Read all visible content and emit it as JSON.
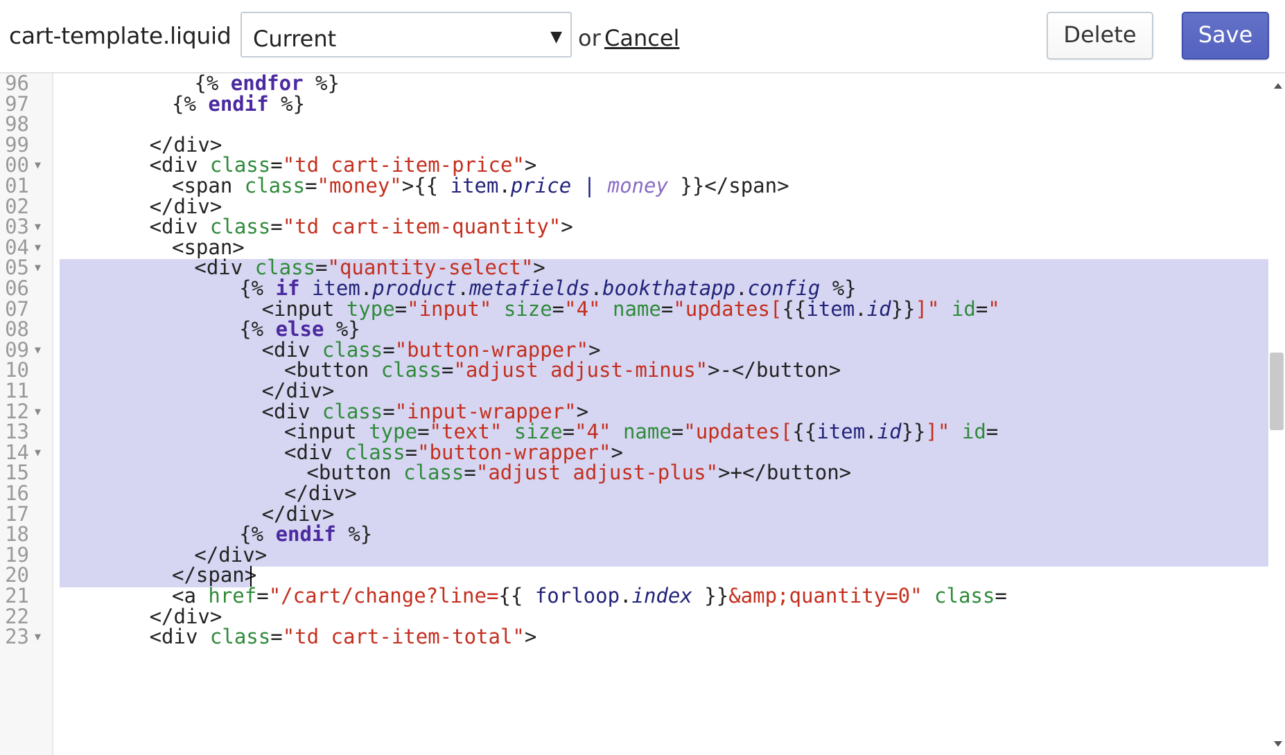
{
  "toolbar": {
    "file_name": "cart-template.liquid",
    "version_select": {
      "selected": "Current"
    },
    "or_text": "or",
    "cancel_label": "Cancel",
    "delete_label": "Delete",
    "save_label": "Save"
  },
  "colors": {
    "save_button": "#5563c1",
    "selection": "#d6d6f2",
    "tag_text": "#222222",
    "attribute": "#2f8a3a",
    "string": "#c42e1e",
    "keyword": "#4b2aa0",
    "variable": "#22227a",
    "filter": "#8a6bc4"
  },
  "editor": {
    "selection": {
      "start_line": "05",
      "end_line": "20"
    },
    "lines": [
      {
        "num": "96",
        "indent": 12,
        "fold": false,
        "tokens": [
          [
            "text",
            "{% "
          ],
          [
            "kw",
            "endfor"
          ],
          [
            "text",
            " %}"
          ]
        ]
      },
      {
        "num": "97",
        "indent": 10,
        "fold": false,
        "tokens": [
          [
            "text",
            "{% "
          ],
          [
            "kw",
            "endif"
          ],
          [
            "text",
            " %}"
          ]
        ]
      },
      {
        "num": "98",
        "indent": 0,
        "fold": false,
        "tokens": []
      },
      {
        "num": "99",
        "indent": 8,
        "fold": false,
        "tokens": [
          [
            "text",
            "</div>"
          ]
        ]
      },
      {
        "num": "00",
        "indent": 8,
        "fold": true,
        "tokens": [
          [
            "text",
            "<div "
          ],
          [
            "attr",
            "class"
          ],
          [
            "text",
            "="
          ],
          [
            "str",
            "\"td cart-item-price\""
          ],
          [
            "text",
            ">"
          ]
        ]
      },
      {
        "num": "01",
        "indent": 10,
        "fold": false,
        "tokens": [
          [
            "text",
            "<span "
          ],
          [
            "attr",
            "class"
          ],
          [
            "text",
            "="
          ],
          [
            "str",
            "\"money\""
          ],
          [
            "text",
            ">{{ "
          ],
          [
            "var",
            "item"
          ],
          [
            "text",
            "."
          ],
          [
            "prop",
            "price"
          ],
          [
            "text",
            " "
          ],
          [
            "punct",
            "|"
          ],
          [
            "text",
            " "
          ],
          [
            "filter",
            "money"
          ],
          [
            "text",
            " }}</span>"
          ]
        ]
      },
      {
        "num": "02",
        "indent": 8,
        "fold": false,
        "tokens": [
          [
            "text",
            "</div>"
          ]
        ]
      },
      {
        "num": "03",
        "indent": 8,
        "fold": true,
        "tokens": [
          [
            "text",
            "<div "
          ],
          [
            "attr",
            "class"
          ],
          [
            "text",
            "="
          ],
          [
            "str",
            "\"td cart-item-quantity\""
          ],
          [
            "text",
            ">"
          ]
        ]
      },
      {
        "num": "04",
        "indent": 10,
        "fold": true,
        "tokens": [
          [
            "text",
            "<span>"
          ]
        ]
      },
      {
        "num": "05",
        "indent": 12,
        "fold": true,
        "tokens": [
          [
            "text",
            "<div "
          ],
          [
            "attr",
            "class"
          ],
          [
            "text",
            "="
          ],
          [
            "str",
            "\"quantity-select\""
          ],
          [
            "text",
            ">"
          ]
        ]
      },
      {
        "num": "06",
        "indent": 16,
        "fold": false,
        "tokens": [
          [
            "text",
            "{% "
          ],
          [
            "kw",
            "if"
          ],
          [
            "text",
            " "
          ],
          [
            "var",
            "item"
          ],
          [
            "text",
            "."
          ],
          [
            "prop",
            "product"
          ],
          [
            "text",
            "."
          ],
          [
            "prop",
            "metafields"
          ],
          [
            "text",
            "."
          ],
          [
            "prop",
            "bookthatapp"
          ],
          [
            "text",
            "."
          ],
          [
            "prop",
            "config"
          ],
          [
            "text",
            " %}"
          ]
        ]
      },
      {
        "num": "07",
        "indent": 18,
        "fold": false,
        "tokens": [
          [
            "text",
            "<input "
          ],
          [
            "attr",
            "type"
          ],
          [
            "text",
            "="
          ],
          [
            "str",
            "\"input\""
          ],
          [
            "text",
            " "
          ],
          [
            "attr",
            "size"
          ],
          [
            "text",
            "="
          ],
          [
            "str",
            "\"4\""
          ],
          [
            "text",
            " "
          ],
          [
            "attr",
            "name"
          ],
          [
            "text",
            "="
          ],
          [
            "str",
            "\"updates["
          ],
          [
            "text",
            "{{"
          ],
          [
            "var",
            "item"
          ],
          [
            "text",
            "."
          ],
          [
            "prop",
            "id"
          ],
          [
            "text",
            "}}"
          ],
          [
            "str",
            "]\""
          ],
          [
            "text",
            " "
          ],
          [
            "attr",
            "id"
          ],
          [
            "text",
            "="
          ],
          [
            "str",
            "\""
          ]
        ]
      },
      {
        "num": "08",
        "indent": 16,
        "fold": false,
        "tokens": [
          [
            "text",
            "{% "
          ],
          [
            "kw",
            "else"
          ],
          [
            "text",
            " %}"
          ]
        ]
      },
      {
        "num": "09",
        "indent": 18,
        "fold": true,
        "tokens": [
          [
            "text",
            "<div "
          ],
          [
            "attr",
            "class"
          ],
          [
            "text",
            "="
          ],
          [
            "str",
            "\"button-wrapper\""
          ],
          [
            "text",
            ">"
          ]
        ]
      },
      {
        "num": "10",
        "indent": 20,
        "fold": false,
        "tokens": [
          [
            "text",
            "<button "
          ],
          [
            "attr",
            "class"
          ],
          [
            "text",
            "="
          ],
          [
            "str",
            "\"adjust adjust-minus\""
          ],
          [
            "text",
            ">-</button>"
          ]
        ]
      },
      {
        "num": "11",
        "indent": 18,
        "fold": false,
        "tokens": [
          [
            "text",
            "</div>"
          ]
        ]
      },
      {
        "num": "12",
        "indent": 18,
        "fold": true,
        "tokens": [
          [
            "text",
            "<div "
          ],
          [
            "attr",
            "class"
          ],
          [
            "text",
            "="
          ],
          [
            "str",
            "\"input-wrapper\""
          ],
          [
            "text",
            ">"
          ]
        ]
      },
      {
        "num": "13",
        "indent": 20,
        "fold": false,
        "tokens": [
          [
            "text",
            "<input "
          ],
          [
            "attr",
            "type"
          ],
          [
            "text",
            "="
          ],
          [
            "str",
            "\"text\""
          ],
          [
            "text",
            " "
          ],
          [
            "attr",
            "size"
          ],
          [
            "text",
            "="
          ],
          [
            "str",
            "\"4\""
          ],
          [
            "text",
            " "
          ],
          [
            "attr",
            "name"
          ],
          [
            "text",
            "="
          ],
          [
            "str",
            "\"updates["
          ],
          [
            "text",
            "{{"
          ],
          [
            "var",
            "item"
          ],
          [
            "text",
            "."
          ],
          [
            "prop",
            "id"
          ],
          [
            "text",
            "}}"
          ],
          [
            "str",
            "]\""
          ],
          [
            "text",
            " "
          ],
          [
            "attr",
            "id"
          ],
          [
            "text",
            "="
          ]
        ]
      },
      {
        "num": "14",
        "indent": 20,
        "fold": true,
        "tokens": [
          [
            "text",
            "<div "
          ],
          [
            "attr",
            "class"
          ],
          [
            "text",
            "="
          ],
          [
            "str",
            "\"button-wrapper\""
          ],
          [
            "text",
            ">"
          ]
        ]
      },
      {
        "num": "15",
        "indent": 22,
        "fold": false,
        "tokens": [
          [
            "text",
            "<button "
          ],
          [
            "attr",
            "class"
          ],
          [
            "text",
            "="
          ],
          [
            "str",
            "\"adjust adjust-plus\""
          ],
          [
            "text",
            ">+</button>"
          ]
        ]
      },
      {
        "num": "16",
        "indent": 20,
        "fold": false,
        "tokens": [
          [
            "text",
            "</div>"
          ]
        ]
      },
      {
        "num": "17",
        "indent": 18,
        "fold": false,
        "tokens": [
          [
            "text",
            "</div>"
          ]
        ]
      },
      {
        "num": "18",
        "indent": 16,
        "fold": false,
        "tokens": [
          [
            "text",
            "{% "
          ],
          [
            "kw",
            "endif"
          ],
          [
            "text",
            " %}"
          ]
        ]
      },
      {
        "num": "19",
        "indent": 12,
        "fold": false,
        "tokens": [
          [
            "text",
            "</div>"
          ]
        ]
      },
      {
        "num": "20",
        "indent": 10,
        "fold": false,
        "tokens": [
          [
            "text",
            "</span>"
          ]
        ]
      },
      {
        "num": "21",
        "indent": 10,
        "fold": false,
        "tokens": [
          [
            "text",
            "<a "
          ],
          [
            "attr",
            "href"
          ],
          [
            "text",
            "="
          ],
          [
            "str",
            "\"/cart/change?line="
          ],
          [
            "text",
            "{{ "
          ],
          [
            "var",
            "forloop"
          ],
          [
            "text",
            "."
          ],
          [
            "prop",
            "index"
          ],
          [
            "text",
            " }}"
          ],
          [
            "str",
            "&amp;quantity=0\""
          ],
          [
            "text",
            " "
          ],
          [
            "attr",
            "class"
          ],
          [
            "text",
            "="
          ]
        ]
      },
      {
        "num": "22",
        "indent": 8,
        "fold": false,
        "tokens": [
          [
            "text",
            "</div>"
          ]
        ]
      },
      {
        "num": "23",
        "indent": 8,
        "fold": true,
        "tokens": [
          [
            "text",
            "<div "
          ],
          [
            "attr",
            "class"
          ],
          [
            "text",
            "="
          ],
          [
            "str",
            "\"td cart-item-total\""
          ],
          [
            "text",
            ">"
          ]
        ]
      }
    ]
  }
}
